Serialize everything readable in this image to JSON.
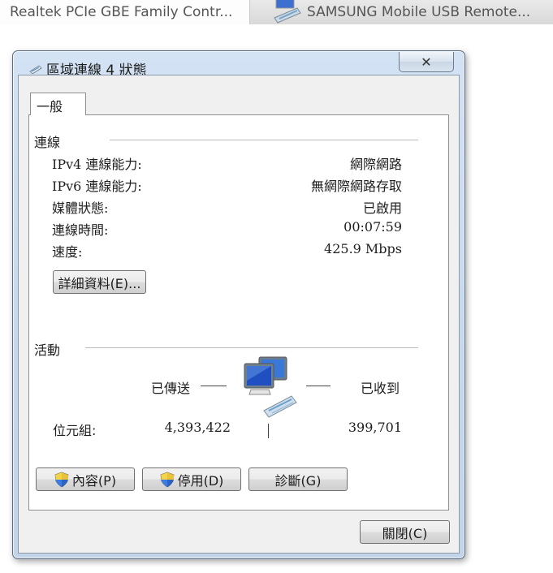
{
  "background_items": [
    {
      "label": "Realtek PCIe GBE Family Contr..."
    },
    {
      "label": "SAMSUNG Mobile USB Remote..."
    }
  ],
  "dialog": {
    "title": "區域連線 4 狀態",
    "close_symbol": "✕",
    "tabs": [
      {
        "label": "一般"
      }
    ],
    "connection": {
      "header": "連線",
      "rows": [
        {
          "label": "IPv4 連線能力:",
          "value": "網際網路"
        },
        {
          "label": "IPv6 連線能力:",
          "value": "無網際網路存取"
        },
        {
          "label": "媒體狀態:",
          "value": "已啟用"
        },
        {
          "label": "連線時間:",
          "value": "00:07:59"
        },
        {
          "label": "速度:",
          "value": "425.9 Mbps"
        }
      ],
      "details_button": "詳細資料(E)..."
    },
    "activity": {
      "header": "活動",
      "sent_label": "已傳送",
      "received_label": "已收到",
      "bytes_label": "位元組:",
      "bytes_sent": "4,393,422",
      "bytes_received": "399,701"
    },
    "buttons": {
      "properties": "內容(P)",
      "disable": "停用(D)",
      "diagnose": "診斷(G)",
      "close": "關閉(C)"
    }
  }
}
